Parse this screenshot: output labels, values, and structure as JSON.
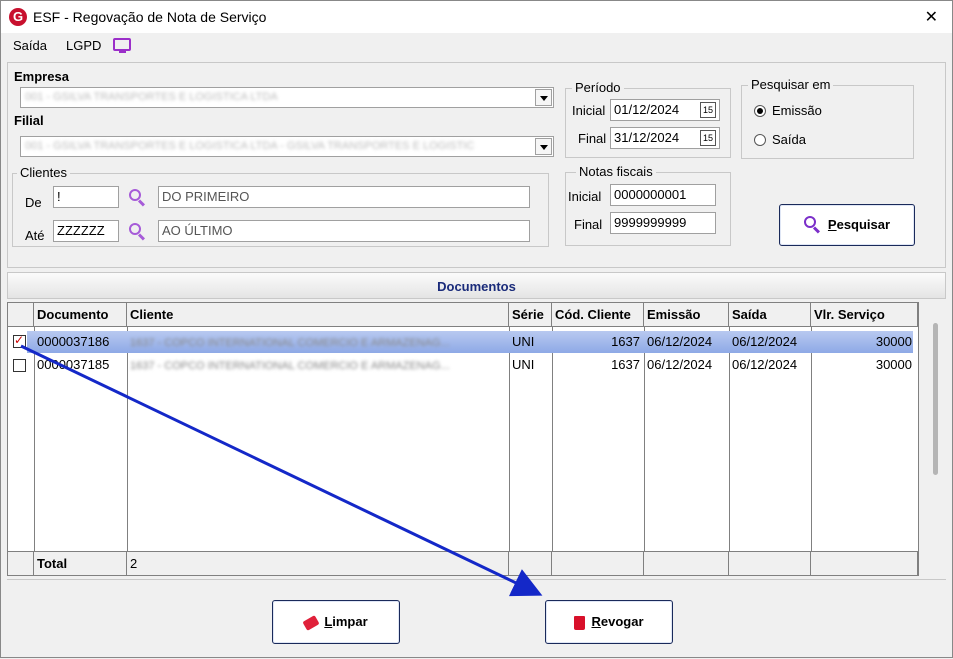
{
  "window": {
    "logo": "G",
    "title": "ESF - Regovação de Nota de Serviço",
    "close": "✕"
  },
  "menu": {
    "saida": "Saída",
    "lgpd": "LGPD"
  },
  "empresa": {
    "label": "Empresa",
    "value": "001 - GSILVA TRANSPORTES E LOGISTICA LTDA"
  },
  "filial": {
    "label": "Filial",
    "value": "001 - GSILVA TRANSPORTES E LOGISTICA LTDA - GSILVA TRANSPORTES E LOGISTIC"
  },
  "clientes": {
    "title": "Clientes",
    "de_label": "De",
    "de_code": "!",
    "de_name": "DO PRIMEIRO",
    "ate_label": "Até",
    "ate_code": "ZZZZZZ",
    "ate_name": "AO ÚLTIMO"
  },
  "periodo": {
    "title": "Período",
    "inicial_label": "Inicial",
    "inicial": "01/12/2024",
    "final_label": "Final",
    "final": "31/12/2024",
    "cal": "15"
  },
  "notas": {
    "title": "Notas fiscais",
    "inicial_label": "Inicial",
    "inicial": "0000000001",
    "final_label": "Final",
    "final": "9999999999"
  },
  "pesquisar_em": {
    "title": "Pesquisar em",
    "options": [
      "Emissão",
      "Saída"
    ],
    "selected": "Emissão"
  },
  "buttons": {
    "pesquisar_first": "P",
    "pesquisar_rest": "esquisar",
    "limpar_first": "L",
    "limpar_rest": "impar",
    "revogar_first": "R",
    "revogar_rest": "evogar"
  },
  "documentos": {
    "title": "Documentos",
    "columns": [
      "Documento",
      "Cliente",
      "Série",
      "Cód. Cliente",
      "Emissão",
      "Saída",
      "Vlr. Serviço"
    ],
    "rows": [
      {
        "checked": true,
        "documento": "0000037186",
        "cliente": "1637 - COPCO INTERNATIONAL COMERCIO E ARMAZENAG...",
        "serie": "UNI",
        "cod_cliente": "1637",
        "emissao": "06/12/2024",
        "saida": "06/12/2024",
        "vlr": "30000"
      },
      {
        "checked": false,
        "documento": "0000037185",
        "cliente": "1637 - COPCO INTERNATIONAL COMERCIO E ARMAZENAG...",
        "serie": "UNI",
        "cod_cliente": "1637",
        "emissao": "06/12/2024",
        "saida": "06/12/2024",
        "vlr": "30000"
      }
    ],
    "total_label": "Total",
    "total_value": "2"
  },
  "colors": {
    "accent": "#1a2b7a",
    "selection": "#8ea9e6",
    "annotation_arrow": "#1428c8",
    "icon_purple": "#a65bd8"
  }
}
